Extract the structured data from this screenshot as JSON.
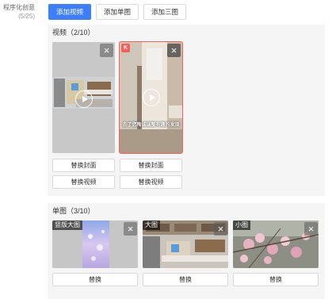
{
  "left_label": {
    "title": "程序化创意",
    "count": "(5/25)"
  },
  "tabs": [
    {
      "label": "添加视频",
      "active": true
    },
    {
      "label": "添加单图",
      "active": false
    },
    {
      "label": "添加三图",
      "active": false
    }
  ],
  "video_section": {
    "title": "视频（2/10）",
    "items": [
      {
        "caption": "",
        "replace_cover": "替换封面",
        "replace_video": "替换视频",
        "selected": false
      },
      {
        "caption": "去了您掏诚瑞整有趣的发现",
        "replace_cover": "替换封面",
        "replace_video": "替换视频",
        "selected": true
      }
    ]
  },
  "image_section": {
    "title": "单图（3/10）",
    "items": [
      {
        "tag": "竖版大图",
        "replace": "替换"
      },
      {
        "tag": "大图",
        "replace": "替换"
      },
      {
        "tag": "小图",
        "replace": "替换"
      }
    ]
  },
  "icons": {
    "close": "×",
    "play": "play-circle-icon"
  },
  "colors": {
    "primary": "#3d7eff",
    "selected_border": "#f5605a",
    "panel_bg": "#f5f5f5"
  }
}
